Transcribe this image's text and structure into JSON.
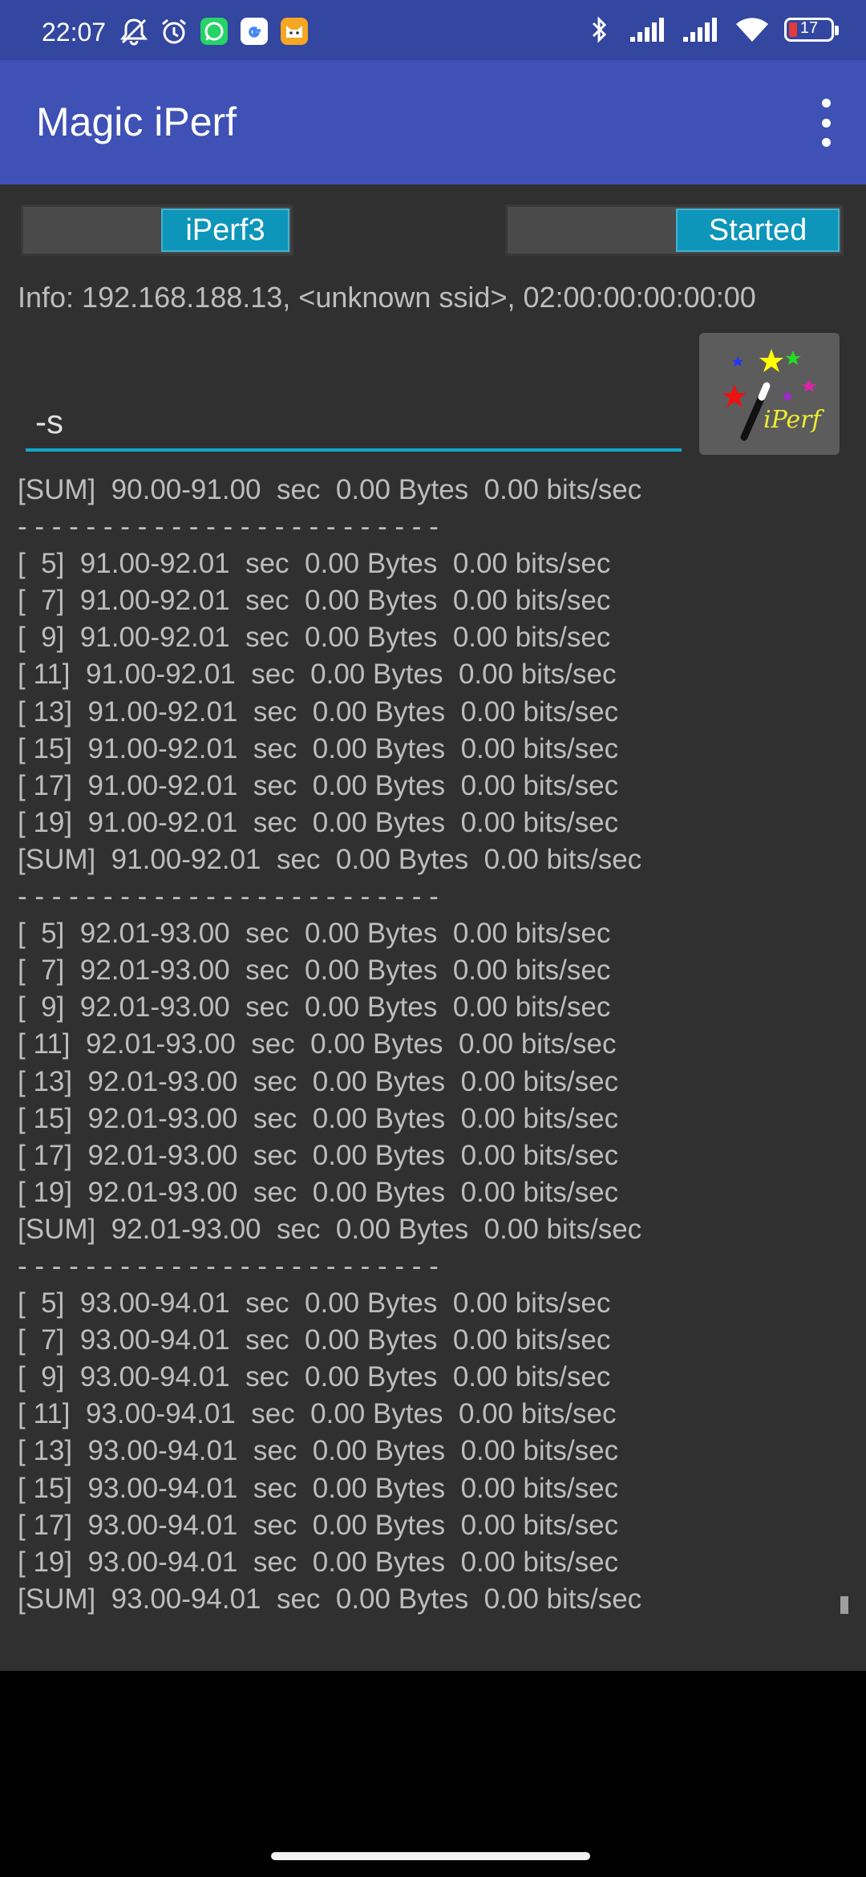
{
  "status_bar": {
    "time": "22:07",
    "left_icons": [
      "muted-notifications-icon",
      "alarm-icon",
      "whatsapp-icon",
      "google-icon",
      "cat-app-icon"
    ],
    "right_icons": [
      "bluetooth-icon",
      "signal-icon",
      "signal-icon",
      "wifi-icon"
    ],
    "battery_level": "17"
  },
  "app_bar": {
    "title": "Magic iPerf",
    "menu_icon": "more-vert-icon"
  },
  "controls": {
    "version_toggle_label": "iPerf3",
    "state_toggle_label": "Started"
  },
  "info_text": "Info: 192.168.188.13, <unknown ssid>, 02:00:00:00:00:00",
  "command": {
    "value": "-s"
  },
  "magic_button": {
    "logo_text": "iPerf",
    "colors": {
      "star_yellow": "#ffff00",
      "star_green": "#22dd22",
      "star_blue": "#2233ff",
      "star_red": "#ee1111",
      "star_magenta": "#dd22aa",
      "logo_text": "#eeee33"
    }
  },
  "log_lines": [
    "[SUM]  90.00-91.00  sec  0.00 Bytes  0.00 bits/sec",
    "- - - - - - - - - - - - - - - - - - - - - - - - -",
    "[  5]  91.00-92.01  sec  0.00 Bytes  0.00 bits/sec",
    "[  7]  91.00-92.01  sec  0.00 Bytes  0.00 bits/sec",
    "[  9]  91.00-92.01  sec  0.00 Bytes  0.00 bits/sec",
    "[ 11]  91.00-92.01  sec  0.00 Bytes  0.00 bits/sec",
    "[ 13]  91.00-92.01  sec  0.00 Bytes  0.00 bits/sec",
    "[ 15]  91.00-92.01  sec  0.00 Bytes  0.00 bits/sec",
    "[ 17]  91.00-92.01  sec  0.00 Bytes  0.00 bits/sec",
    "[ 19]  91.00-92.01  sec  0.00 Bytes  0.00 bits/sec",
    "[SUM]  91.00-92.01  sec  0.00 Bytes  0.00 bits/sec",
    "- - - - - - - - - - - - - - - - - - - - - - - - -",
    "[  5]  92.01-93.00  sec  0.00 Bytes  0.00 bits/sec",
    "[  7]  92.01-93.00  sec  0.00 Bytes  0.00 bits/sec",
    "[  9]  92.01-93.00  sec  0.00 Bytes  0.00 bits/sec",
    "[ 11]  92.01-93.00  sec  0.00 Bytes  0.00 bits/sec",
    "[ 13]  92.01-93.00  sec  0.00 Bytes  0.00 bits/sec",
    "[ 15]  92.01-93.00  sec  0.00 Bytes  0.00 bits/sec",
    "[ 17]  92.01-93.00  sec  0.00 Bytes  0.00 bits/sec",
    "[ 19]  92.01-93.00  sec  0.00 Bytes  0.00 bits/sec",
    "[SUM]  92.01-93.00  sec  0.00 Bytes  0.00 bits/sec",
    "- - - - - - - - - - - - - - - - - - - - - - - - -",
    "[  5]  93.00-94.01  sec  0.00 Bytes  0.00 bits/sec",
    "[  7]  93.00-94.01  sec  0.00 Bytes  0.00 bits/sec",
    "[  9]  93.00-94.01  sec  0.00 Bytes  0.00 bits/sec",
    "[ 11]  93.00-94.01  sec  0.00 Bytes  0.00 bits/sec",
    "[ 13]  93.00-94.01  sec  0.00 Bytes  0.00 bits/sec",
    "[ 15]  93.00-94.01  sec  0.00 Bytes  0.00 bits/sec",
    "[ 17]  93.00-94.01  sec  0.00 Bytes  0.00 bits/sec",
    "[ 19]  93.00-94.01  sec  0.00 Bytes  0.00 bits/sec",
    "[SUM]  93.00-94.01  sec  0.00 Bytes  0.00 bits/sec"
  ],
  "theme": {
    "status_bar_bg": "#3346a0",
    "app_bar_bg": "#3f51b5",
    "content_bg": "#303030",
    "accent": "#0e95ba",
    "text": "#bdbdbd"
  }
}
